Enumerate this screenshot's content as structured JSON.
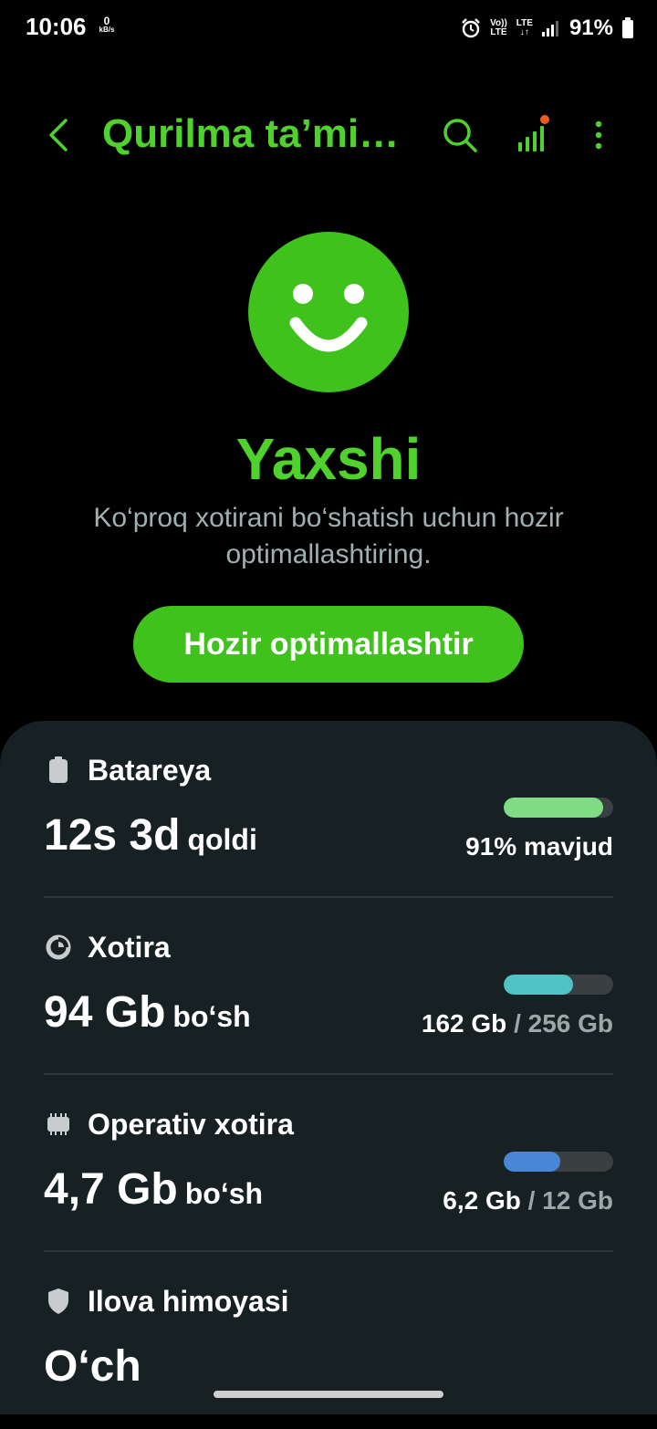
{
  "status_bar": {
    "time": "10:06",
    "net_speed_value": "0",
    "net_speed_unit": "kB/s",
    "volte_line1": "Vo))",
    "volte_line2": "LTE",
    "lte_label": "LTE",
    "battery_percent": "91%"
  },
  "app_bar": {
    "title": "Qurilma ta’minoti",
    "accent_color": "#4fd12e",
    "icons": [
      "back-arrow-icon",
      "search-icon",
      "stats-bars-icon",
      "more-options-icon"
    ]
  },
  "hero": {
    "status": "Yaxshi",
    "description": "Ko‘proq xotirani bo‘shatish uchun hozir optimallashtiring.",
    "optimize_button": "Hozir optimallashtir"
  },
  "items": [
    {
      "label": "Batareya",
      "icon": "battery-icon",
      "value_big": "12s 3d",
      "value_small": "qoldi",
      "meta_main": "91% mavjud",
      "meta_rest": "",
      "level": 0.91,
      "bar_color": "#7fdc85"
    },
    {
      "label": "Xotira",
      "icon": "storage-pie-icon",
      "value_big": "94 Gb",
      "value_small": "bo‘sh",
      "meta_main": "162 Gb",
      "meta_rest": "/ 256 Gb",
      "level": 0.63,
      "bar_color": "#4fc3c6"
    },
    {
      "label": "Operativ xotira",
      "icon": "memory-chip-icon",
      "value_big": "4,7 Gb",
      "value_small": "bo‘sh",
      "meta_main": "6,2 Gb",
      "meta_rest": "/ 12 Gb",
      "level": 0.52,
      "bar_color": "#4a86d6"
    },
    {
      "label": "Ilova himoyasi",
      "icon": "shield-icon",
      "value_big": "O‘ch"
    }
  ]
}
